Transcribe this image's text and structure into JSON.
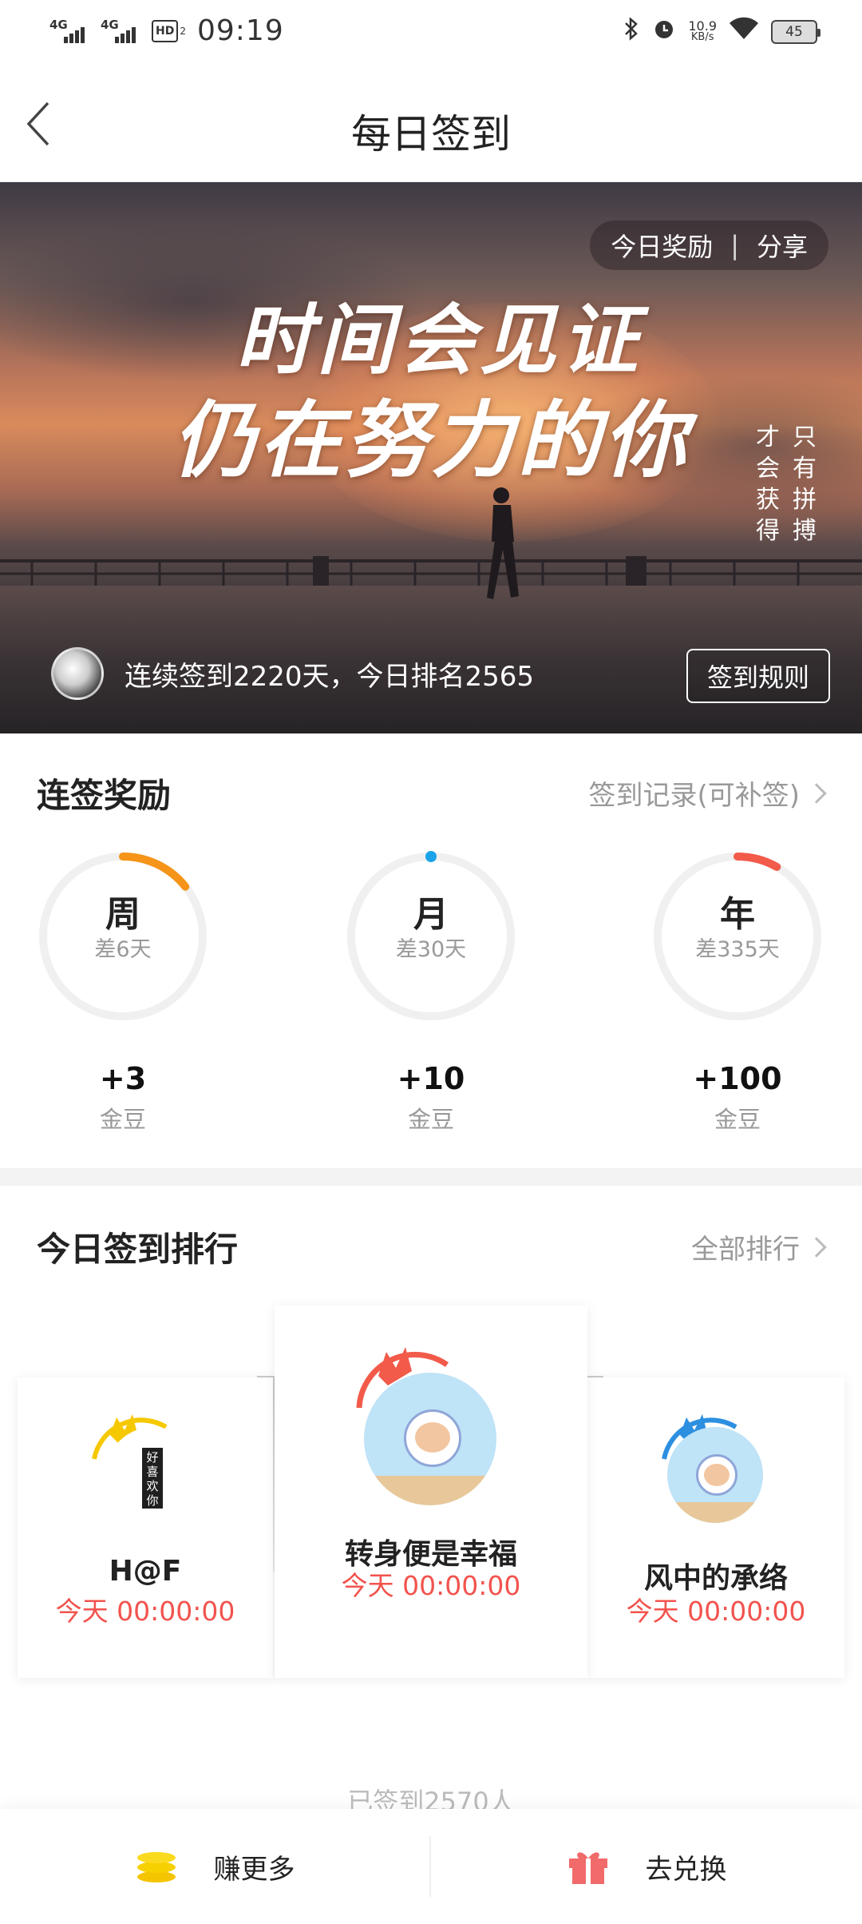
{
  "status_bar": {
    "network_1": "4G",
    "network_2": "4G",
    "hd": "HD",
    "hd_sub": "2",
    "time": "09:19",
    "speed_value": "10.9",
    "speed_unit": "KB/s",
    "battery": "45"
  },
  "header": {
    "title": "每日签到"
  },
  "banner": {
    "actions": {
      "reward": "今日奖励",
      "separator": "|",
      "share": "分享"
    },
    "slogan_line1": "时间会见证",
    "slogan_line2": "仍在努力的你",
    "vertical_col1": "才会获得",
    "vertical_col2": "只有拼搏",
    "streak_text": "连续签到2220天，今日排名2565",
    "rules_button": "签到规则"
  },
  "rewards_section": {
    "title": "连签奖励",
    "link": "签到记录(可补签)",
    "items": [
      {
        "name": "周",
        "remain": "差6天",
        "amount": "+3",
        "unit": "金豆",
        "progress": 0.143,
        "color": "#f59418"
      },
      {
        "name": "月",
        "remain": "差30天",
        "amount": "+10",
        "unit": "金豆",
        "progress": 0.0,
        "color": "#1aa3e8"
      },
      {
        "name": "年",
        "remain": "差335天",
        "amount": "+100",
        "unit": "金豆",
        "progress": 0.082,
        "color": "#f25a4a"
      }
    ]
  },
  "ranking_section": {
    "title": "今日签到排行",
    "link": "全部排行",
    "first": {
      "name": "转身便是幸福",
      "time": "今天 00:00:00"
    },
    "second": {
      "name": "H@F",
      "time": "今天 00:00:00",
      "avatar_text": "好喜欢你"
    },
    "third": {
      "name": "风中的承络",
      "time": "今天 00:00:00"
    },
    "signed_count": "已签到2570人"
  },
  "bottom_bar": {
    "earn": "赚更多",
    "exchange": "去兑换"
  },
  "colors": {
    "accent_red": "#f2534e",
    "week": "#f59418",
    "month": "#1aa3e8",
    "year": "#f25a4a",
    "gold": "#f7c600",
    "gift": "#f26b6b"
  }
}
